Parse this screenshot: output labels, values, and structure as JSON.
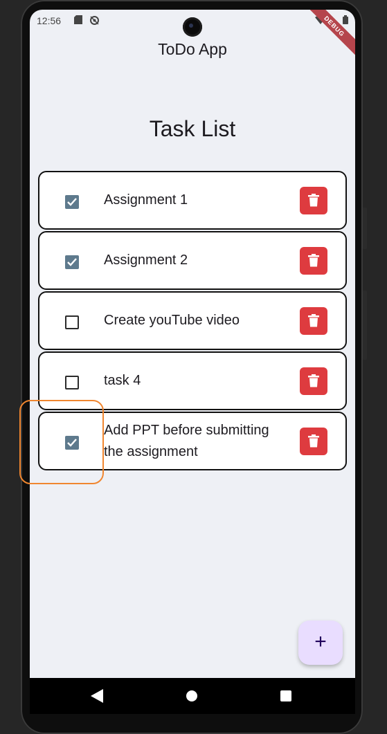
{
  "status_bar": {
    "time": "12:56",
    "icons": [
      "sd-card-icon",
      "sync-off-icon",
      "wifi-icon",
      "battery-icon"
    ]
  },
  "debug_banner": "DEBUG",
  "app_bar": {
    "title": "ToDo App"
  },
  "page": {
    "title": "Task List"
  },
  "tasks": [
    {
      "label": "Assignment 1",
      "checked": true
    },
    {
      "label": "Assignment 2",
      "checked": true
    },
    {
      "label": "Create youTube video",
      "checked": false
    },
    {
      "label": "task 4",
      "checked": false
    },
    {
      "label": "Add PPT before submitting the assignment",
      "checked": true
    }
  ],
  "fab": {
    "label": "+"
  },
  "colors": {
    "checkbox_checked": "#5e7a8d",
    "delete_button": "#de3b3f",
    "fab_background": "#e9ddff",
    "highlight": "#f0862f",
    "screen_background": "#eef0f5"
  },
  "nav_bar": {
    "icons": [
      "back-icon",
      "home-icon",
      "recents-icon"
    ]
  }
}
